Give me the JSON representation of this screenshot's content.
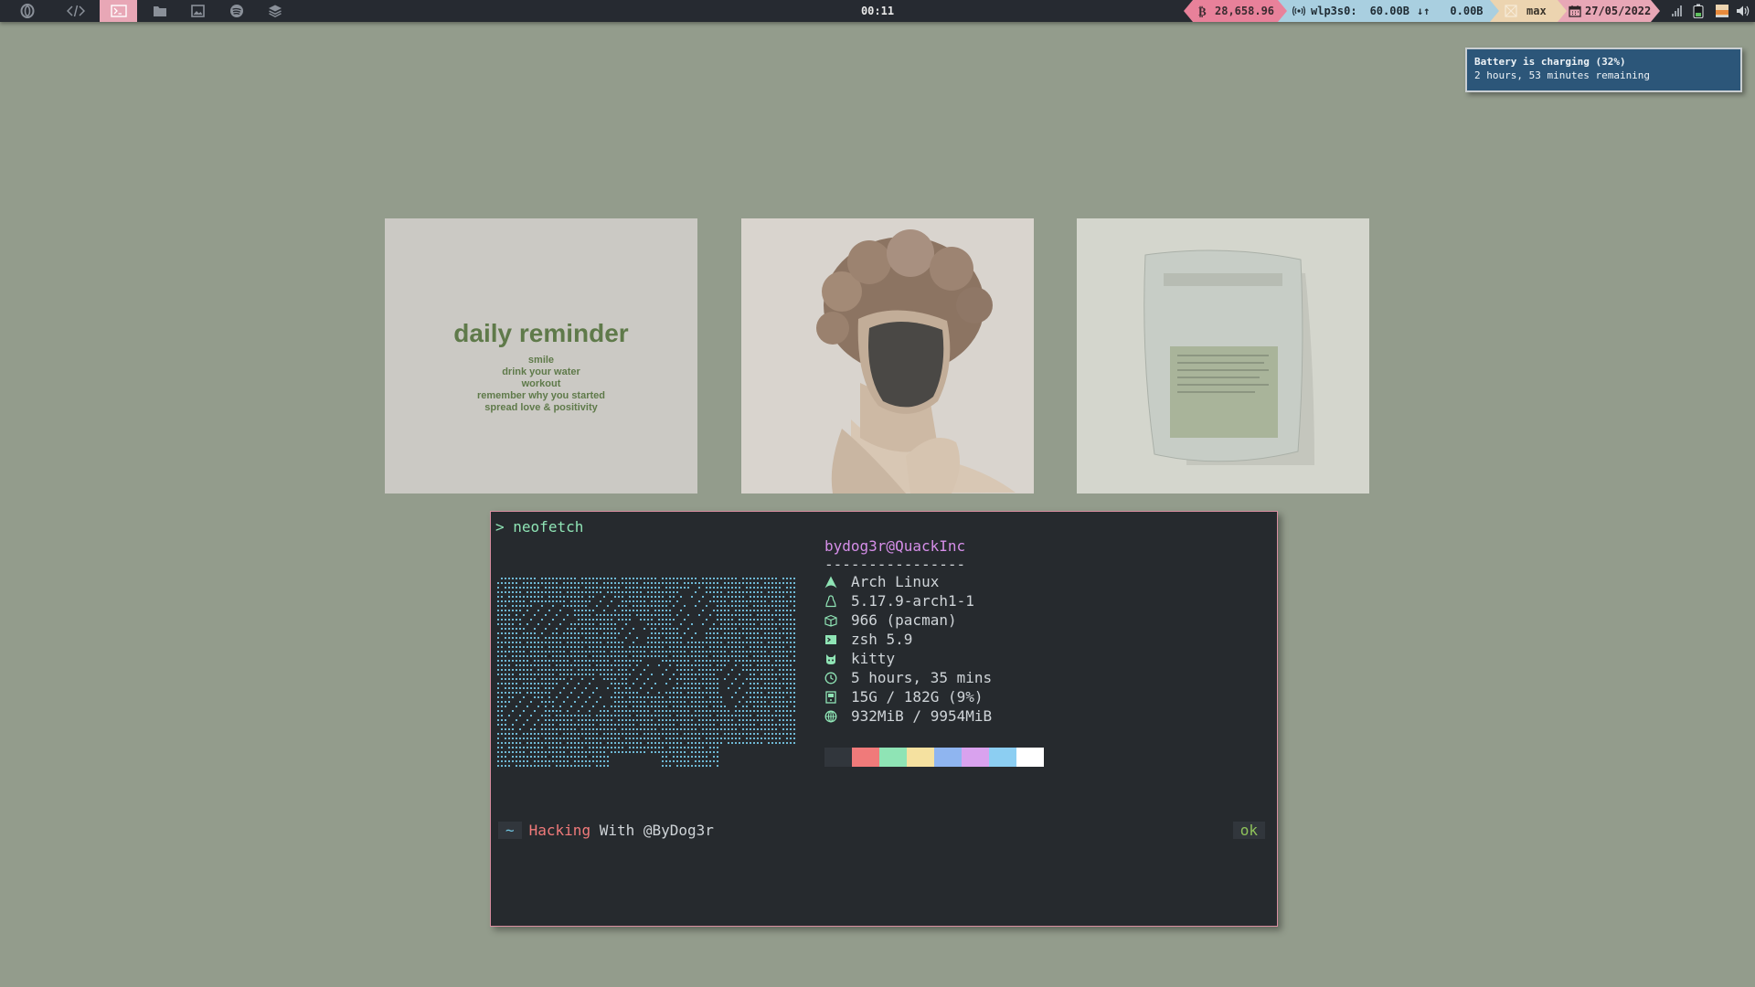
{
  "topbar": {
    "workspaces": [
      {
        "icon": "opera-icon"
      },
      {
        "icon": "code-icon"
      },
      {
        "icon": "terminal-icon",
        "active": true
      },
      {
        "icon": "folder-icon"
      },
      {
        "icon": "image-icon"
      },
      {
        "icon": "spotify-icon"
      },
      {
        "icon": "layers-icon"
      }
    ],
    "clock": "00:11",
    "bitcoin": {
      "icon": "bitcoin-icon",
      "value": "28,658.96",
      "color": "#e8819a"
    },
    "network": {
      "icon": "wifi-icon",
      "interface": "wlp3s0:",
      "down": "60.00B",
      "arrows": "↓↑",
      "up": "0.00B",
      "color": "#a9cfe0"
    },
    "brightness": {
      "icon": "brightness-icon",
      "label": "max",
      "color": "#ecd4b0"
    },
    "date": {
      "icon": "calendar-icon",
      "value": "27/05/2022",
      "color": "#e8a7b6"
    },
    "tray": [
      "signal-icon",
      "battery-icon",
      "sound-level-icon",
      "volume-icon"
    ]
  },
  "notification": {
    "title": "Battery is charging (32%)",
    "body": "2 hours, 53 minutes remaining",
    "color": "#2c5679"
  },
  "wallpapers": {
    "reminder": {
      "title": "daily reminder",
      "lines": [
        "smile",
        "drink your water",
        "workout",
        "remember why you started",
        "spread love & positivity"
      ]
    }
  },
  "terminal": {
    "prompt_arrow": ">",
    "command": "neofetch",
    "user_host": "bydog3r@QuackInc",
    "separator": "----------------",
    "info": [
      {
        "icon": "arch-icon",
        "text": "Arch Linux"
      },
      {
        "icon": "linux-icon",
        "text": "5.17.9-arch1-1"
      },
      {
        "icon": "package-icon",
        "text": "966 (pacman)"
      },
      {
        "icon": "shell-icon",
        "text": "zsh 5.9"
      },
      {
        "icon": "cat-icon",
        "text": "kitty"
      },
      {
        "icon": "clock-icon",
        "text": "5 hours, 35 mins"
      },
      {
        "icon": "disk-icon",
        "text": "15G / 182G (9%)"
      },
      {
        "icon": "memory-icon",
        "text": "932MiB / 9954MiB"
      }
    ],
    "palette": [
      "#31363c",
      "#f07a7a",
      "#8fe4b5",
      "#f5e1a0",
      "#8fb5f0",
      "#d9a2ee",
      "#8ccef2",
      "#ffffff"
    ],
    "footer": {
      "tilde": "~",
      "word1": "Hacking",
      "word2": " With @ByDog3r",
      "status": "ok"
    }
  }
}
